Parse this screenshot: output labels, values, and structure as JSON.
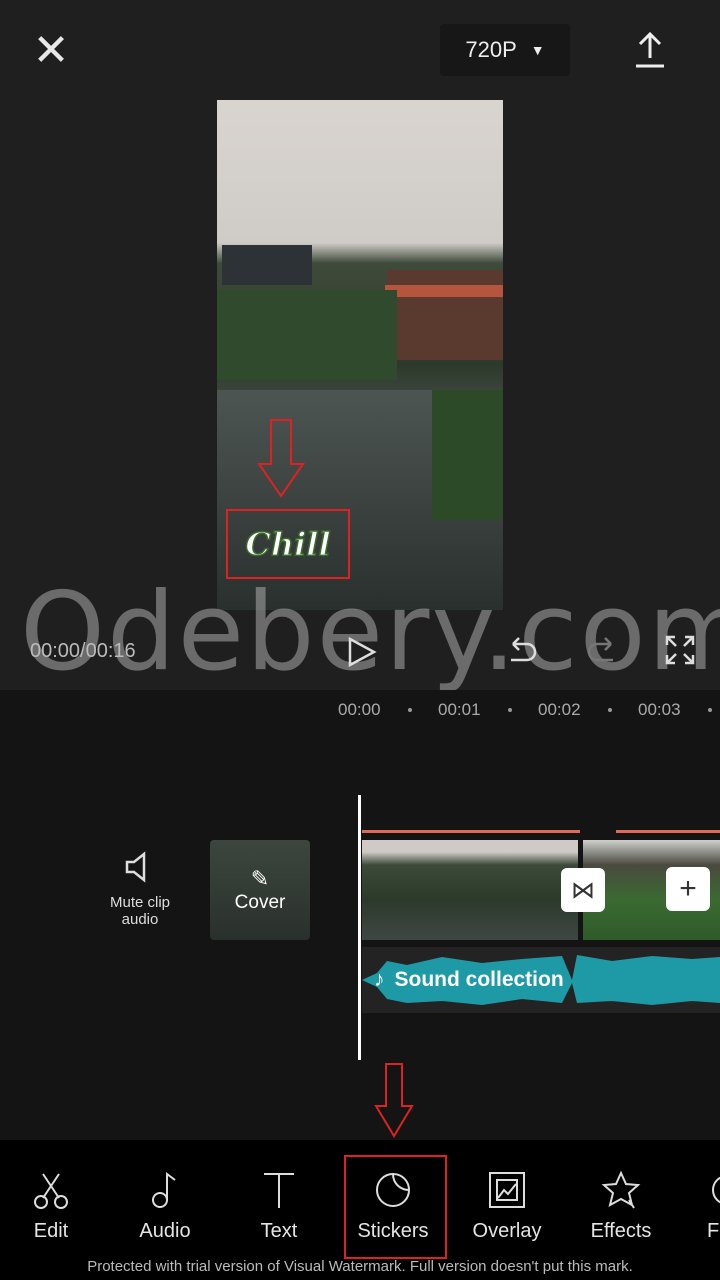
{
  "header": {
    "resolution": "720P",
    "icons": [
      "close-icon",
      "caret-down-icon",
      "export-icon"
    ]
  },
  "preview": {
    "sticker_text": "Chill",
    "watermark": "Odebery.com",
    "time": "00:00/00:16"
  },
  "timeline": {
    "ticks": [
      "00:00",
      "00:01",
      "00:02",
      "00:03"
    ],
    "mute_label": "Mute clip audio",
    "cover_label": "Cover",
    "audio_label": "Sound collection",
    "accent": "#1e9aa6"
  },
  "toolbar": {
    "items": [
      {
        "label": "Edit"
      },
      {
        "label": "Audio"
      },
      {
        "label": "Text"
      },
      {
        "label": "Stickers"
      },
      {
        "label": "Overlay"
      },
      {
        "label": "Effects"
      },
      {
        "label": "Fi"
      }
    ]
  },
  "footer": {
    "watermark_notice": "Protected with trial version of Visual Watermark. Full version doesn't put this mark."
  }
}
